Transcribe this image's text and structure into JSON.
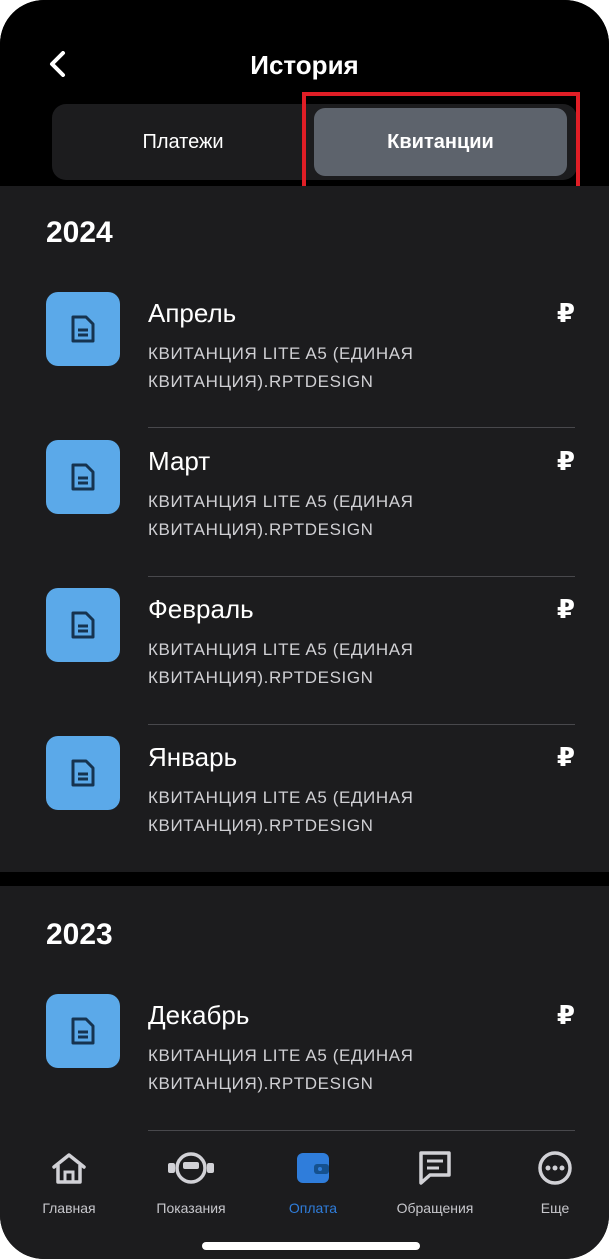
{
  "header": {
    "title": "История",
    "back_icon": "chevron-left-icon"
  },
  "segments": {
    "payments": "Платежи",
    "receipts": "Квитанции",
    "selected": "receipts"
  },
  "colors": {
    "accent": "#2f7ddb",
    "document_tile": "#5ba9e9",
    "highlight": "#e01e26"
  },
  "sections": [
    {
      "year": "2024",
      "items": [
        {
          "title": "Апрель",
          "subtitle": "КВИТАНЦИЯ LITE A5 (ЕДИНАЯ КВИТАНЦИЯ).RPTDESIGN",
          "currency": "₽"
        },
        {
          "title": "Март",
          "subtitle": "КВИТАНЦИЯ LITE A5 (ЕДИНАЯ КВИТАНЦИЯ).RPTDESIGN",
          "currency": "₽"
        },
        {
          "title": "Февраль",
          "subtitle": "КВИТАНЦИЯ LITE A5 (ЕДИНАЯ КВИТАНЦИЯ).RPTDESIGN",
          "currency": "₽"
        },
        {
          "title": "Январь",
          "subtitle": "КВИТАНЦИЯ LITE A5 (ЕДИНАЯ КВИТАНЦИЯ).RPTDESIGN",
          "currency": "₽"
        }
      ]
    },
    {
      "year": "2023",
      "items": [
        {
          "title": "Декабрь",
          "subtitle": "КВИТАНЦИЯ LITE A5 (ЕДИНАЯ КВИТАНЦИЯ).RPTDESIGN",
          "currency": "₽"
        }
      ]
    }
  ],
  "tabbar": {
    "active": "Оплата",
    "items": [
      {
        "label": "Главная",
        "icon": "home-icon"
      },
      {
        "label": "Показания",
        "icon": "meter-icon"
      },
      {
        "label": "Оплата",
        "icon": "wallet-icon"
      },
      {
        "label": "Обращения",
        "icon": "chat-icon"
      },
      {
        "label": "Еще",
        "icon": "more-icon"
      }
    ]
  }
}
